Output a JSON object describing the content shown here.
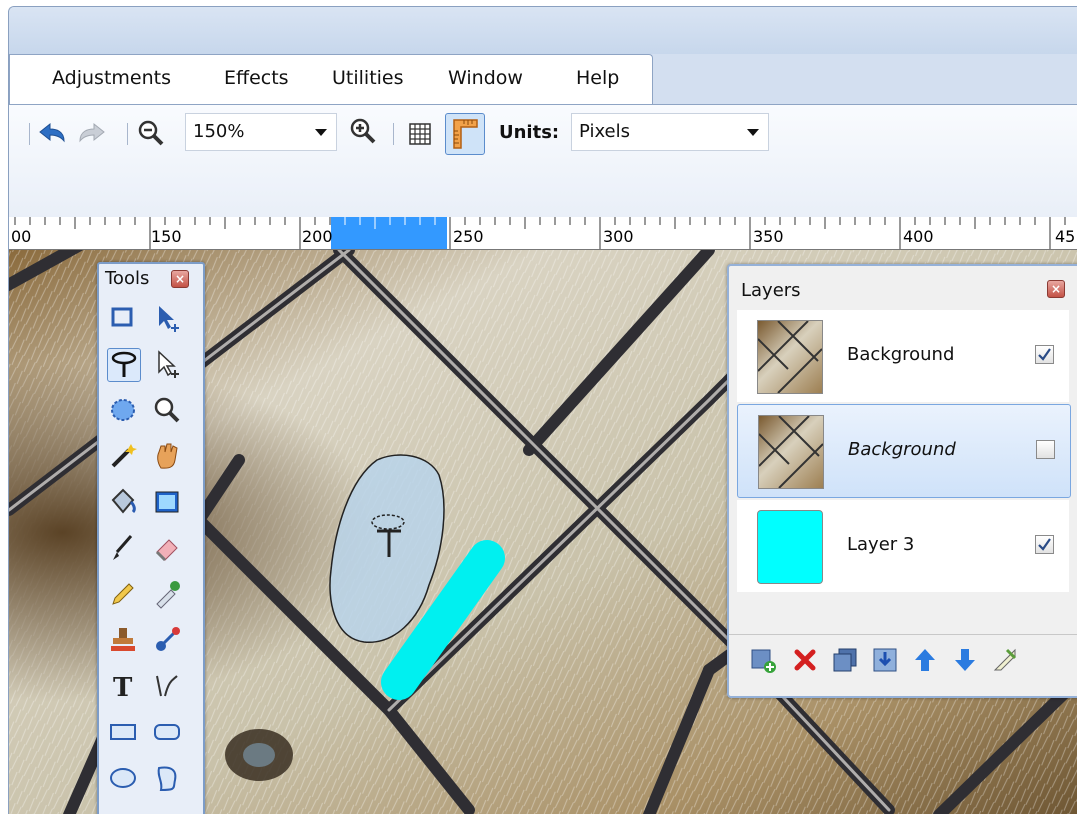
{
  "menu": {
    "items": [
      "Adjustments",
      "Effects",
      "Utilities",
      "Window",
      "Help"
    ]
  },
  "toolbar": {
    "zoom_value": "150%",
    "units_label": "Units:",
    "units_value": "Pixels"
  },
  "ruler": {
    "labels": [
      "00",
      "150",
      "200",
      "250",
      "300",
      "350",
      "400",
      "45"
    ]
  },
  "tools_window": {
    "title": "Tools"
  },
  "layers_window": {
    "title": "Layers",
    "layers": [
      {
        "name": "Background",
        "visible": true,
        "selected": false,
        "italic": false
      },
      {
        "name": "Background",
        "visible": false,
        "selected": true,
        "italic": true
      },
      {
        "name": "Layer 3",
        "visible": true,
        "selected": false,
        "italic": false
      }
    ]
  },
  "colors": {
    "accent": "#3399ff",
    "brush": "#00f0f0",
    "window_border": "#7c9cc8"
  },
  "icons": [
    "undo-icon",
    "redo-icon",
    "zoom-out-icon",
    "zoom-in-icon",
    "grid-icon",
    "ruler-icon",
    "rectangle-select-icon",
    "move-selection-icon",
    "lasso-select-icon",
    "move-selected-icon",
    "ellipse-select-icon",
    "zoom-tool-icon",
    "magic-wand-icon",
    "pan-icon",
    "paint-bucket-icon",
    "gradient-icon",
    "paintbrush-icon",
    "eraser-icon",
    "pencil-icon",
    "color-picker-icon",
    "clone-stamp-icon",
    "recolor-icon",
    "text-icon",
    "line-curve-icon",
    "rectangle-icon",
    "rounded-rectangle-icon",
    "ellipse-icon",
    "freeform-shape-icon",
    "add-layer-icon",
    "delete-layer-icon",
    "duplicate-layer-icon",
    "merge-layer-down-icon",
    "move-layer-up-icon",
    "move-layer-down-icon",
    "layer-properties-icon"
  ]
}
